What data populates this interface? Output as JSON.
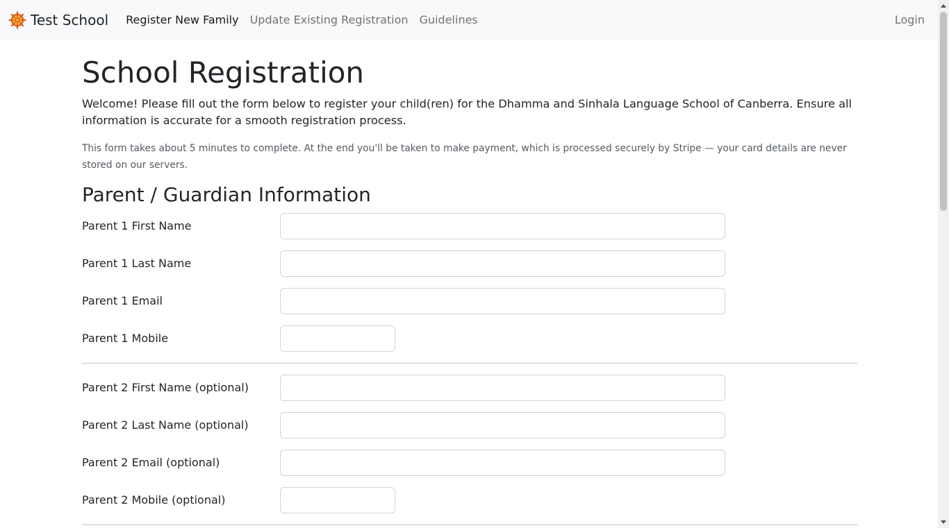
{
  "navbar": {
    "brand": "Test School",
    "logo_icon": "dharma-wheel-icon",
    "links": [
      {
        "label": "Register New Family",
        "active": true
      },
      {
        "label": "Update Existing Registration",
        "active": false
      },
      {
        "label": "Guidelines",
        "active": false
      }
    ],
    "login": "Login"
  },
  "page": {
    "title": "School Registration",
    "lead": "Welcome! Please fill out the form below to register your child(ren) for the Dhamma and Sinhala Language School of Canberra. Ensure all information is accurate for a smooth registration process.",
    "note": "This form takes about 5 minutes to complete. At the end you'll be taken to make payment, which is processed securely by Stripe — your card details are never stored on our servers."
  },
  "section": {
    "title": "Parent / Guardian Information"
  },
  "fields": [
    {
      "label": "Parent 1 First Name",
      "value": ""
    },
    {
      "label": "Parent 1 Last Name",
      "value": ""
    },
    {
      "label": "Parent 1 Email",
      "value": ""
    },
    {
      "label": "Parent 1 Mobile",
      "value": ""
    },
    {
      "label": "Parent 2 First Name (optional)",
      "value": ""
    },
    {
      "label": "Parent 2 Last Name (optional)",
      "value": ""
    },
    {
      "label": "Parent 2 Email (optional)",
      "value": ""
    },
    {
      "label": "Parent 2 Mobile (optional)",
      "value": ""
    }
  ],
  "colors": {
    "navbar_bg": "#f8f9fa",
    "logo_primary": "#e0541c",
    "logo_secondary": "#f2b134"
  }
}
